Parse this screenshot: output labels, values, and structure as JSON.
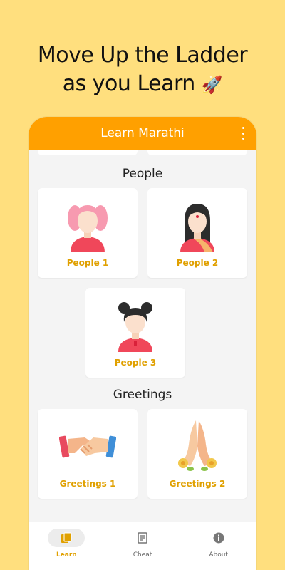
{
  "headline": {
    "line1": "Move Up the Ladder",
    "line2": "as you Learn",
    "emoji": "🚀"
  },
  "appbar": {
    "title": "Learn Marathi",
    "menu_icon": "more-vert-icon"
  },
  "sections": [
    {
      "title": "People",
      "cards": [
        {
          "label": "People 1",
          "icon": "girl-pigtails-icon"
        },
        {
          "label": "People 2",
          "icon": "woman-bindi-icon"
        },
        {
          "label": "People 3",
          "icon": "girl-buns-icon"
        }
      ]
    },
    {
      "title": "Greetings",
      "cards": [
        {
          "label": "Greetings 1",
          "icon": "handshake-icon"
        },
        {
          "label": "Greetings 2",
          "icon": "namaste-hands-icon"
        }
      ]
    }
  ],
  "bottom_nav": [
    {
      "label": "Learn",
      "icon": "cards-icon",
      "active": true
    },
    {
      "label": "Cheat",
      "icon": "notes-icon",
      "active": false
    },
    {
      "label": "About",
      "icon": "info-icon",
      "active": false
    }
  ],
  "colors": {
    "background": "#FFDF7E",
    "appbar": "#FFA000",
    "accent": "#E0A000"
  }
}
